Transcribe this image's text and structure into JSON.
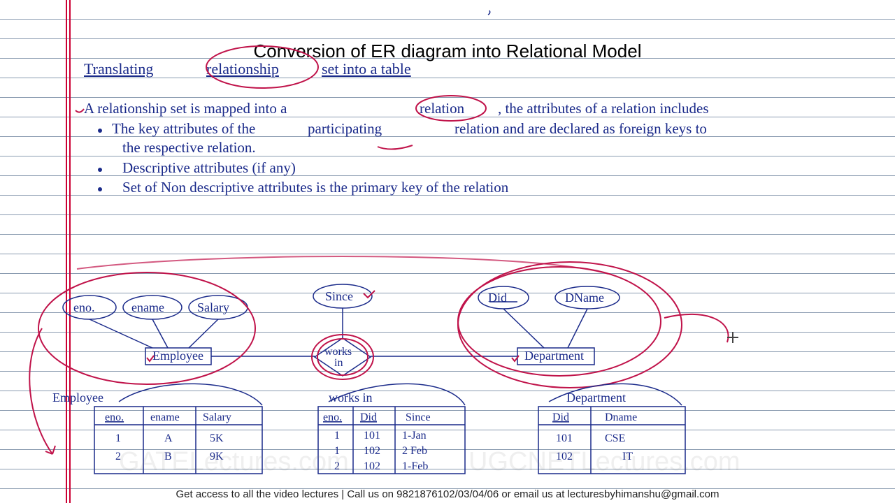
{
  "print_title": "Conversion of ER diagram into Relational Model",
  "heading": {
    "part1": "Translating",
    "part2": "relationship",
    "part3": "set into a table"
  },
  "lines": {
    "l1a": "A relationship set is mapped into a",
    "l1b": "relation",
    "l1c": ", the attributes of a relation includes",
    "l2a": "The key attributes of the",
    "l2b": "participating",
    "l2c": "relation and are declared as foreign keys to",
    "l3": "the respective relation.",
    "l4": "Descriptive attributes (if any)",
    "l5": "Set of Non descriptive attributes is the primary key of the relation"
  },
  "er": {
    "employee": {
      "label": "Employee",
      "attrs": [
        "eno.",
        "ename",
        "Salary"
      ]
    },
    "works": {
      "label": "works in",
      "attr": "Since"
    },
    "department": {
      "label": "Department",
      "attrs": [
        "Did",
        "DName"
      ]
    }
  },
  "tables": {
    "employee": {
      "title": "Employee",
      "cols": [
        "eno.",
        "ename",
        "Salary"
      ],
      "rows": [
        [
          "1",
          "A",
          "5K"
        ],
        [
          "2",
          "B",
          "9K"
        ]
      ]
    },
    "works": {
      "title": "works in",
      "cols": [
        "eno.",
        "Did",
        "Since"
      ],
      "rows": [
        [
          "1",
          "101",
          "1-Jan"
        ],
        [
          "1",
          "102",
          "2 Feb"
        ],
        [
          "2",
          "102",
          "1-Feb"
        ]
      ]
    },
    "department": {
      "title": "Department",
      "cols": [
        "Did",
        "Dname"
      ],
      "rows": [
        [
          "101",
          "CSE"
        ],
        [
          "102",
          "IT"
        ]
      ]
    }
  },
  "watermarks": {
    "left": "GATELectures.com",
    "right": "UGCNETLectures.com"
  },
  "footer": "Get access to all the video lectures | Call us on 9821876102/03/04/06 or email us at lecturesbyhimanshu@gmail.com"
}
